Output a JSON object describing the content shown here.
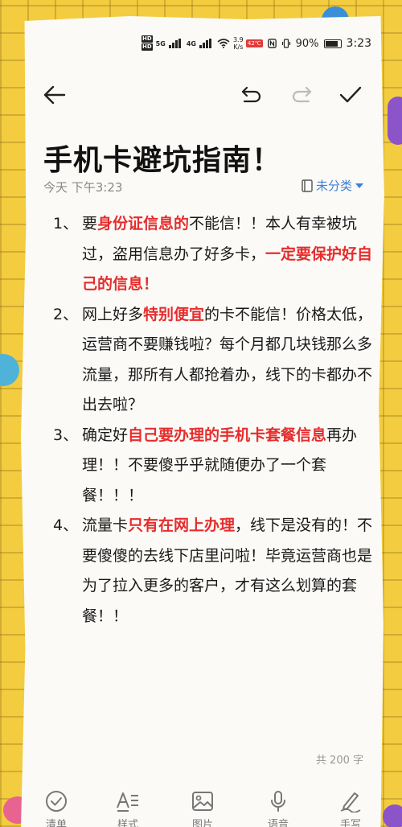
{
  "status_bar": {
    "hd_badges": [
      "HD",
      "HD"
    ],
    "network_labels": [
      "5G",
      "4G"
    ],
    "speed": "3.9",
    "speed_unit": "K/s",
    "badge": "42℃",
    "battery_text": "90%",
    "battery_level": 0.9,
    "time": "3:23"
  },
  "toolbar": {
    "back_icon": "arrow-left-icon",
    "undo_icon": "undo-icon",
    "redo_icon": "redo-icon",
    "done_icon": "check-icon"
  },
  "note": {
    "title": "手机卡避坑指南！",
    "date": "今天 下午3:23",
    "category": "未分类",
    "paragraphs": [
      {
        "num": "1、",
        "segments": [
          {
            "text": "要",
            "hl": false
          },
          {
            "text": "身份证信息的",
            "hl": true
          },
          {
            "text": "不能信！！本人有幸被坑过，盗用信息办了好多卡，",
            "hl": false
          },
          {
            "text": "一定要保护好自己的信息！",
            "hl": true
          }
        ]
      },
      {
        "num": "2、",
        "segments": [
          {
            "text": "网上好多",
            "hl": false
          },
          {
            "text": "特别便宜",
            "hl": true
          },
          {
            "text": "的卡不能信！价格太低，运营商不要赚钱啦？每个月都几块钱那么多流量，那所有人都抢着办，线下的卡都办不出去啦？",
            "hl": false
          }
        ]
      },
      {
        "num": "3、",
        "segments": [
          {
            "text": "确定好",
            "hl": false
          },
          {
            "text": "自己要办理的手机卡套餐信息",
            "hl": true
          },
          {
            "text": "再办理！！不要傻乎乎就随便办了一个套餐！！！",
            "hl": false
          }
        ]
      },
      {
        "num": "4、",
        "segments": [
          {
            "text": "流量卡",
            "hl": false
          },
          {
            "text": "只有在网上办理",
            "hl": true
          },
          {
            "text": "，线下是没有的！不要傻傻的去线下店里问啦！毕竟运营商也是为了拉入更多的客户，才有这么划算的套餐！！",
            "hl": false
          }
        ]
      }
    ],
    "word_count": "共 200 字"
  },
  "bottom_bar": {
    "items": [
      {
        "label": "清单",
        "icon": "checklist-icon"
      },
      {
        "label": "样式",
        "icon": "text-style-icon"
      },
      {
        "label": "图片",
        "icon": "image-icon"
      },
      {
        "label": "语音",
        "icon": "microphone-icon"
      },
      {
        "label": "手写",
        "icon": "handwriting-icon"
      }
    ]
  },
  "colors": {
    "highlight": "#e52d2d",
    "accent": "#3f7fd8",
    "background": "#f3cc3f",
    "paper": "#fbfaf7"
  }
}
